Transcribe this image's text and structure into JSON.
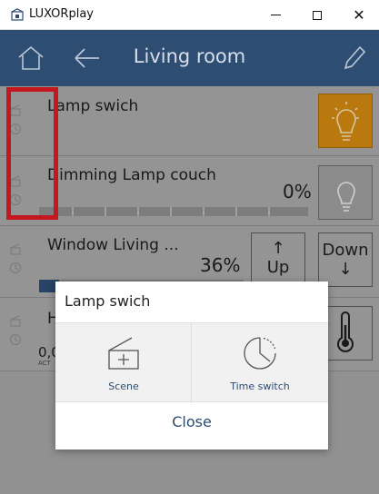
{
  "window": {
    "title": "LUXORplay",
    "min_icon": "minimize-icon",
    "max_icon": "maximize-icon",
    "close_glyph": "✕"
  },
  "header": {
    "title": "Living room",
    "home_icon": "home-icon",
    "back_icon": "back-arrow-icon",
    "edit_icon": "pencil-icon"
  },
  "rows": [
    {
      "label": "Lamp swich",
      "state": "on"
    },
    {
      "label": "Dimming Lamp couch",
      "percent": "0%",
      "state": "off"
    },
    {
      "label": "Window Living ...",
      "percent": "36%",
      "up_label": "Up",
      "up_arrow": "↑",
      "down_label": "Down",
      "down_arrow": "↓",
      "level": 0.36
    },
    {
      "label": "H",
      "value": "0,0",
      "sub": "ACT"
    }
  ],
  "dialog": {
    "title": "Lamp swich",
    "scene_label": "Scene",
    "time_switch_label": "Time switch",
    "close_label": "Close"
  },
  "colors": {
    "header": "#2e4d73",
    "accent_on": "#d38a12",
    "highlight": "#e01b24",
    "dialog_text": "#2d4a70"
  }
}
